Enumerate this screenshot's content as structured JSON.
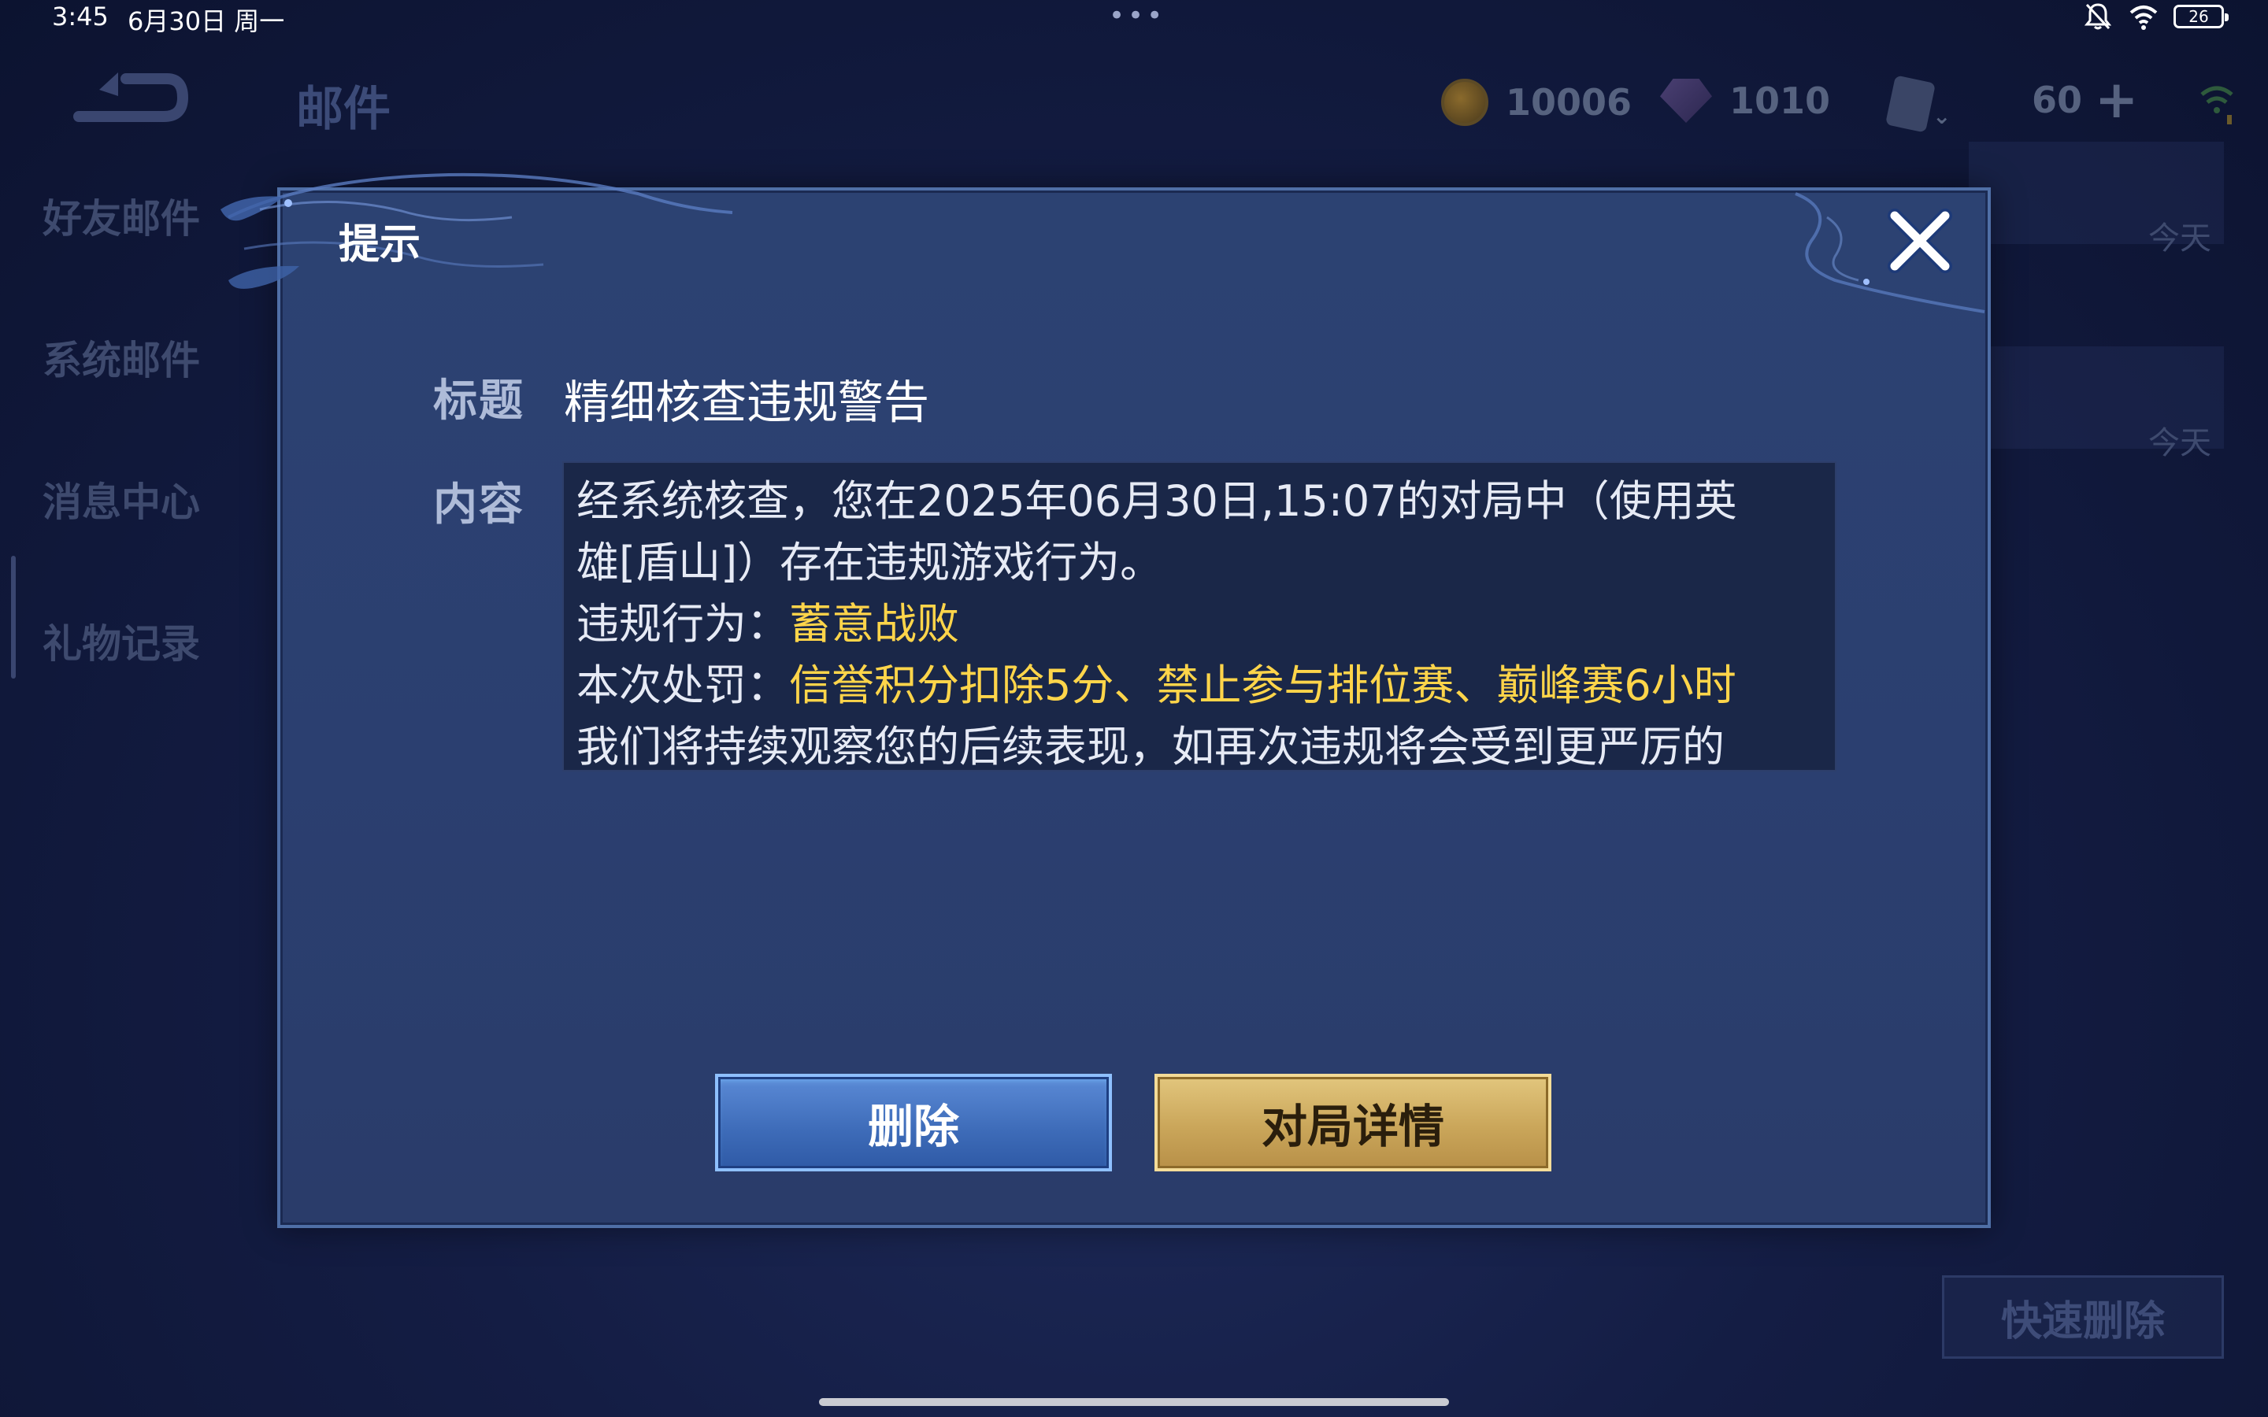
{
  "status_bar": {
    "time": "3:45",
    "date": "6月30日 周一",
    "battery": "26"
  },
  "header": {
    "title": "邮件",
    "gold_coins": "10006",
    "gems": "1010",
    "energy": "60"
  },
  "sidebar": {
    "items": [
      {
        "label": "好友邮件"
      },
      {
        "label": "系统邮件"
      },
      {
        "label": "消息中心"
      },
      {
        "label": "礼物记录"
      }
    ]
  },
  "mail_list": {
    "rows": [
      {
        "date": "今天"
      },
      {
        "date": "今天"
      }
    ]
  },
  "quick_delete_label": "快速删除",
  "dialog": {
    "title": "提示",
    "subject_label": "标题",
    "subject": "精细核查违规警告",
    "content_label": "内容",
    "content": {
      "line1": "经系统核查，您在2025年06月30日,15:07的对局中（使用英",
      "line2": "雄[盾山]）存在违规游戏行为。",
      "violation_label": "违规行为：",
      "violation_value": "蓄意战败",
      "penalty_label": "本次处罚：",
      "penalty_value": "信誉积分扣除5分、禁止参与排位赛、巅峰赛6小时",
      "line5": "我们将持续观察您的后续表现，如再次违规将会受到更严厉的"
    },
    "delete_label": "删除",
    "details_label": "对局详情"
  },
  "colors": {
    "highlight": "#ffd54a",
    "dialog_bg": "#2c4272",
    "delete_button": "#3d6bb8",
    "details_button": "#caa65a"
  }
}
